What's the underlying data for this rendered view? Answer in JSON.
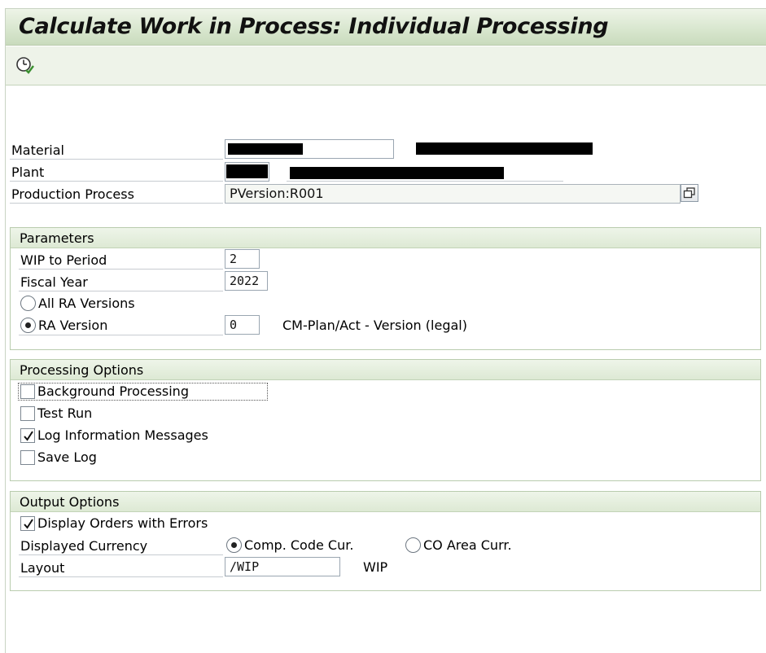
{
  "window": {
    "title": "Calculate Work in Process: Individual Processing"
  },
  "toolbar": {
    "execute_icon": "execute-clock-icon"
  },
  "header": {
    "material_label": "Material",
    "plant_label": "Plant",
    "production_process_label": "Production Process",
    "production_process_value": "PVersion:R001"
  },
  "parameters": {
    "title": "Parameters",
    "wip_to_period_label": "WIP to Period",
    "wip_to_period_value": "2",
    "fiscal_year_label": "Fiscal Year",
    "fiscal_year_value": "2022",
    "all_ra_versions_label": "All RA Versions",
    "ra_version_label": "RA Version",
    "ra_version_value": "0",
    "ra_version_desc": "CM-Plan/Act - Version (legal)",
    "selected": "RA Version"
  },
  "processing": {
    "title": "Processing Options",
    "background_label": "Background Processing",
    "background_checked": false,
    "test_run_label": "Test Run",
    "test_run_checked": false,
    "log_info_label": "Log Information Messages",
    "log_info_checked": true,
    "save_log_label": "Save Log",
    "save_log_checked": false
  },
  "output": {
    "title": "Output Options",
    "display_errors_label": "Display Orders with Errors",
    "display_errors_checked": true,
    "currency_label": "Displayed Currency",
    "comp_code_label": "Comp. Code Cur.",
    "co_area_label": "CO Area Curr.",
    "currency_selected": "Comp. Code Cur.",
    "layout_label": "Layout",
    "layout_value": "/WIP",
    "layout_desc": "WIP"
  }
}
